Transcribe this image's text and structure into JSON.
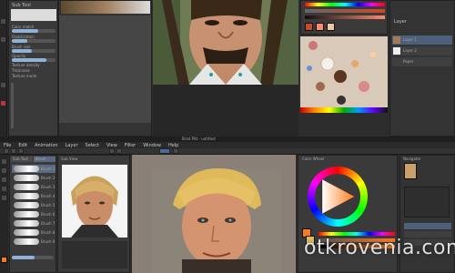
{
  "top": {
    "brush_panel_title": "Sub Tool",
    "brush_labels": [
      "Color match",
      "Stabilization",
      "Brush size",
      "Opacity",
      "Texture density",
      "Thickness",
      "Texture mode"
    ],
    "layer_panel_title": "Layer",
    "layers": [
      "Layer 1",
      "Layer 2",
      "Paper"
    ],
    "colors": [
      "#c94a2a",
      "#ff8a6b",
      "#e9c7a0",
      "#8a5a40",
      "#2f5ec7"
    ]
  },
  "bottom": {
    "window_title": "Brad Pitt - untitled",
    "menu": [
      "File",
      "Edit",
      "Animation",
      "Layer",
      "Select",
      "View",
      "Filter",
      "Window",
      "Help"
    ],
    "subtool_tabs": [
      "Sub Tool",
      "Brush"
    ],
    "brush_names": [
      "Brush 1",
      "Brush 2",
      "Brush 3",
      "Brush 4",
      "Brush 5",
      "Brush 6",
      "Brush 7",
      "Brush 8",
      "Brush 9"
    ],
    "reference_title": "Sub View",
    "navigator_title": "Navigator",
    "color_title": "Color Wheel",
    "accent": "#ff7a1a"
  },
  "watermark": "otkrovenia.com"
}
